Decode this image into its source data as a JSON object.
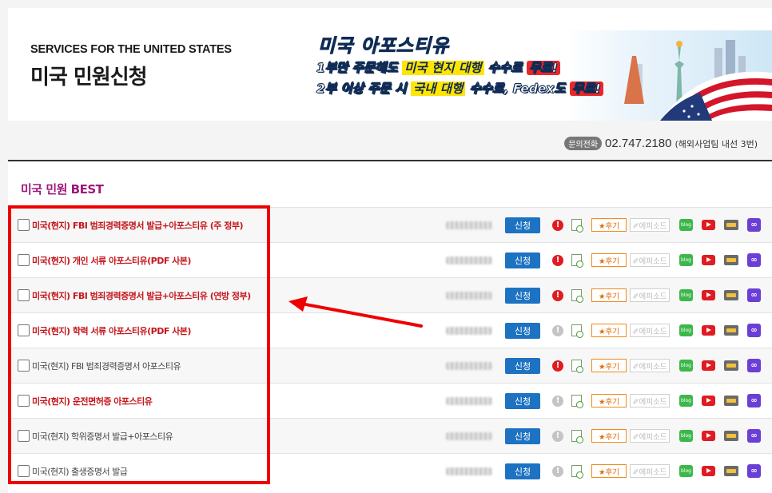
{
  "banner": {
    "subtitle": "SERVICES FOR THE UNITED STATES",
    "title": "미국 민원신청",
    "promo_title": "미국 아포스티유",
    "promo_line1_prefix": "1부만 주문해도 ",
    "promo_line1_highlight": "미국 현지 대행",
    "promo_line1_middle": " 수수료 ",
    "promo_line1_free": "무료!",
    "promo_line2_prefix": "2부 이상 주문 시 ",
    "promo_line2_highlight": "국내 대행",
    "promo_line2_middle": " 수수료, Fedex도 ",
    "promo_line2_free": "무료!"
  },
  "contact": {
    "tag": "문의전화",
    "number": "02.747.2180",
    "note": "(해외사업팀 내선 3번)"
  },
  "section": {
    "title": "미국 민원 BEST"
  },
  "row_buttons": {
    "apply": "신청",
    "review": "★후기",
    "episode": "✐에피소드",
    "blog": "blog"
  },
  "rows": [
    {
      "label": "미국(현지) FBI 범죄경력증명서 발급+아포스티유 (주 정부)",
      "highlight": true,
      "alert": true
    },
    {
      "label": "미국(현지) 개인 서류 아포스티유(PDF 사본)",
      "highlight": true,
      "alert": true
    },
    {
      "label": "미국(현지) FBI 범죄경력증명서 발급+아포스티유 (연방 정부)",
      "highlight": true,
      "alert": true
    },
    {
      "label": "미국(현지) 학력 서류 아포스티유(PDF 사본)",
      "highlight": true,
      "alert": false
    },
    {
      "label": "미국(현지) FBI 범죄경력증명서 아포스티유",
      "highlight": false,
      "alert": true
    },
    {
      "label": "미국(현지) 운전면허증 아포스티유",
      "highlight": true,
      "alert": false
    },
    {
      "label": "미국(현지) 학위증명서 발급+아포스티유",
      "highlight": false,
      "alert": false
    },
    {
      "label": "미국(현지) 출생증명서 발급",
      "highlight": false,
      "alert": false
    }
  ],
  "colors": {
    "accent": "#a0177a",
    "highlight_text": "#c4161c",
    "apply_button": "#1d72c2",
    "annotation": "#ee0000"
  }
}
